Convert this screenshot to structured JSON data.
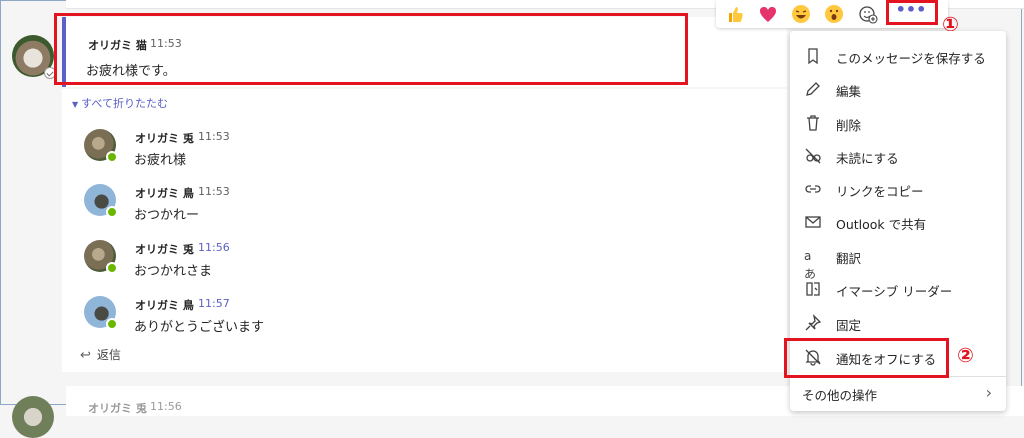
{
  "main_message": {
    "author": "オリガミ 猫",
    "time": "11:53",
    "body": "お疲れ様です。"
  },
  "collapse_label": "すべて折りたたむ",
  "replies": [
    {
      "author": "オリガミ 兎",
      "time": "11:53",
      "text": "お疲れ様",
      "avatar": "rabbit",
      "time_color": "#616161"
    },
    {
      "author": "オリガミ 鳥",
      "time": "11:53",
      "text": "おつかれー",
      "avatar": "bird",
      "time_color": "#616161"
    },
    {
      "author": "オリガミ 兎",
      "time": "11:56",
      "text": "おつかれさま",
      "avatar": "rabbit",
      "time_color": "#5b5fc7"
    },
    {
      "author": "オリガミ 鳥",
      "time": "11:57",
      "text": "ありがとうございます",
      "avatar": "bird",
      "time_color": "#5b5fc7"
    }
  ],
  "reply_label": "返信",
  "next_message": {
    "author": "オリガミ 兎",
    "time": "11:56"
  },
  "reactions": [
    "thumbs-up",
    "heart",
    "laugh",
    "surprised",
    "add-reaction"
  ],
  "more_button": "•••",
  "annotations": {
    "step1": "①",
    "step2": "②"
  },
  "menu": {
    "items": [
      {
        "icon": "bookmark-icon",
        "label": "このメッセージを保存する"
      },
      {
        "icon": "pencil-icon",
        "label": "編集"
      },
      {
        "icon": "trash-icon",
        "label": "削除"
      },
      {
        "icon": "eye-off-icon",
        "label": "未読にする"
      },
      {
        "icon": "link-icon",
        "label": "リンクをコピー"
      },
      {
        "icon": "mail-icon",
        "label": "Outlook で共有"
      },
      {
        "icon": "translate-icon",
        "label": "翻訳"
      },
      {
        "icon": "immersive-reader-icon",
        "label": "イマーシブ リーダー"
      },
      {
        "icon": "pin-icon",
        "label": "固定"
      },
      {
        "icon": "bell-off-icon",
        "label": "通知をオフにする"
      },
      {
        "icon": "",
        "label": "その他の操作"
      }
    ]
  },
  "colors": {
    "accent": "#5b5fc7",
    "annotation_red": "#e3141f",
    "presence_green": "#6bb700"
  }
}
